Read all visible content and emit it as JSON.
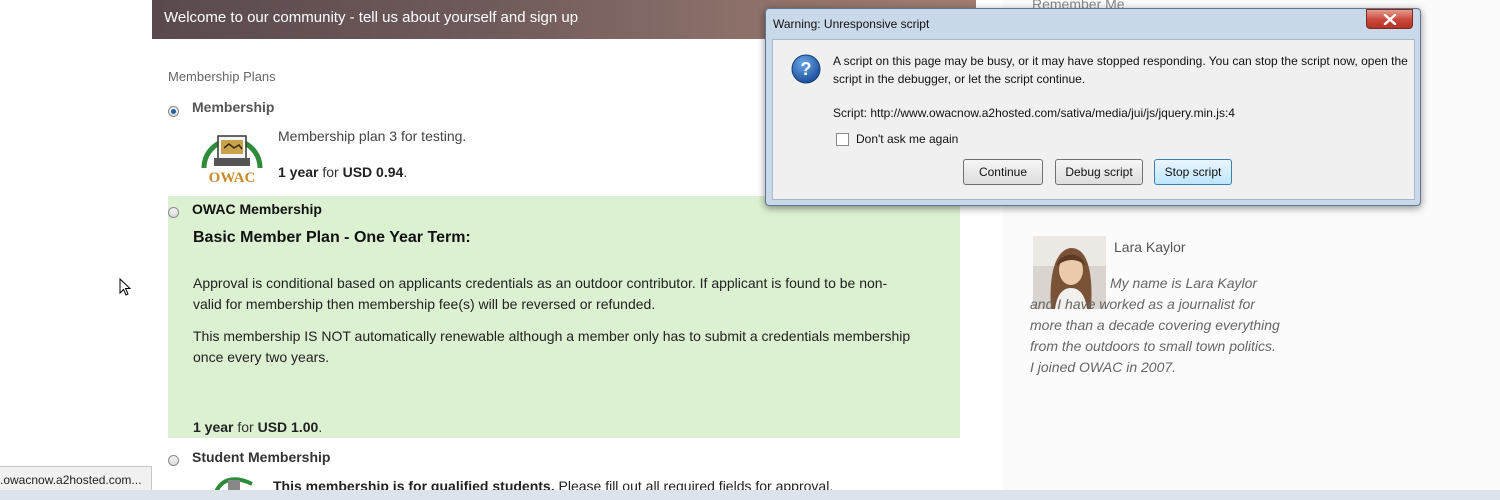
{
  "banner": {
    "text": "Welcome to our community - tell us about yourself and sign up"
  },
  "plans": {
    "heading": "Membership Plans",
    "items": [
      {
        "title": "Membership",
        "selected": true,
        "description": "Membership plan 3 for testing.",
        "price_term": "1 year",
        "price_for": " for ",
        "price_value": "USD 0.94",
        "price_end": ".",
        "logo_text": "OWAC"
      },
      {
        "title": "OWAC Membership",
        "selected": false,
        "subtitle": "Basic Member Plan - One Year Term:",
        "para1": "Approval is conditional based on applicants credentials as an outdoor contributor.  If applicant is found to be non-valid for membership then membership fee(s) will be reversed or refunded.",
        "para2": "This membership IS NOT automatically renewable although a member only has to submit a credentials membership once every two years.",
        "price_term": "1 year",
        "price_for": " for ",
        "price_value": "USD 1.00",
        "price_end": "."
      },
      {
        "title": "Student Membership",
        "selected": false,
        "desc_bold": "This membership is for qualified students.",
        "desc_rest": "  Please fill out all required fields for approval."
      }
    ]
  },
  "sidebar": {
    "remember_me": "Remember Me",
    "profile": {
      "name": "Lara Kaylor",
      "bio_first": "My name is Lara Kaylor and I have worked as a journalist for more than a decade covering everything from the outdoors to small town politics. I joined OWAC in 2007."
    }
  },
  "status_bar": {
    "text": ".owacnow.a2hosted.com..."
  },
  "dialog": {
    "title": "Warning: Unresponsive script",
    "message": "A script on this page may be busy, or it may have stopped responding. You can stop the script now, open the script in the debugger, or let the script continue.",
    "script_label": "Script: http://www.owacnow.a2hosted.com/sativa/media/jui/js/jquery.min.js:4",
    "checkbox_label": "Don't ask me again",
    "buttons": {
      "continue": "Continue",
      "debug": "Debug script",
      "stop": "Stop script"
    }
  },
  "colors": {
    "green_panel": "#dcf0d2",
    "dialog_frame": "#c9d9ea",
    "close_button": "#c8473a",
    "radio_selected": "#1f5fa8"
  }
}
